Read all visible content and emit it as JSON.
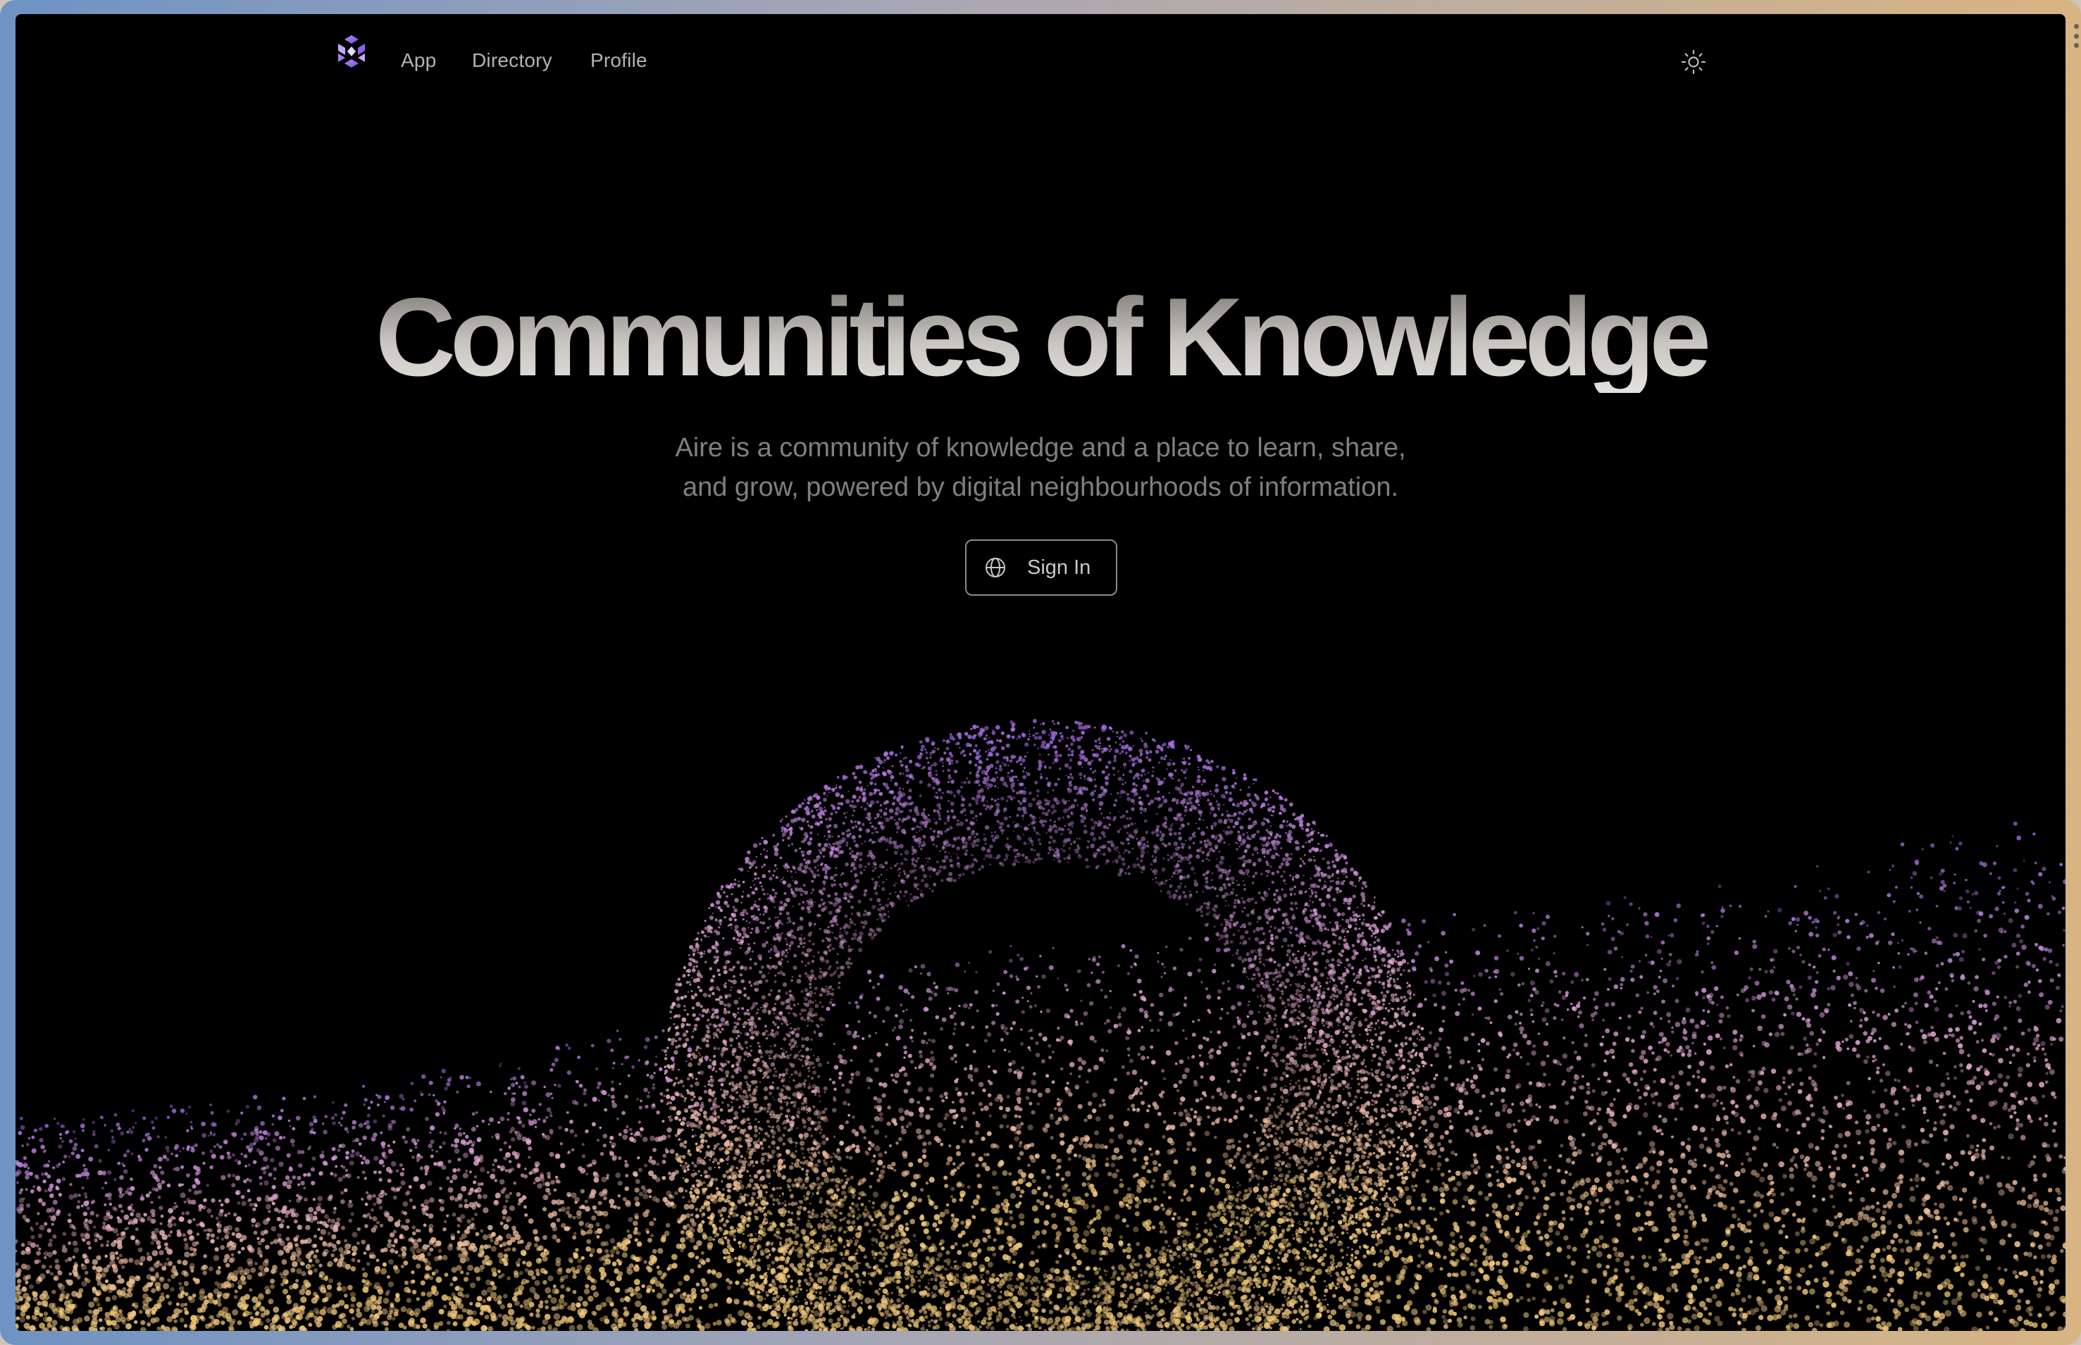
{
  "nav": {
    "logo_icon": "aire-hexagon-logo-icon",
    "links": [
      {
        "label": "App"
      },
      {
        "label": "Directory"
      },
      {
        "label": "Profile"
      }
    ],
    "theme_toggle_icon": "sun-icon"
  },
  "hero": {
    "title": "Communities of Knowledge",
    "subtitle_line1": "Aire is a community of knowledge and a place to learn, share,",
    "subtitle_line2": "and grow, powered by digital neighbourhoods of information.",
    "signin_label": "Sign In",
    "signin_icon": "globe-icon"
  },
  "colors": {
    "background": "#000000",
    "particle_purple": "#9a62e8",
    "particle_pink": "#e2a3d6",
    "particle_gold": "#f0c77a"
  }
}
